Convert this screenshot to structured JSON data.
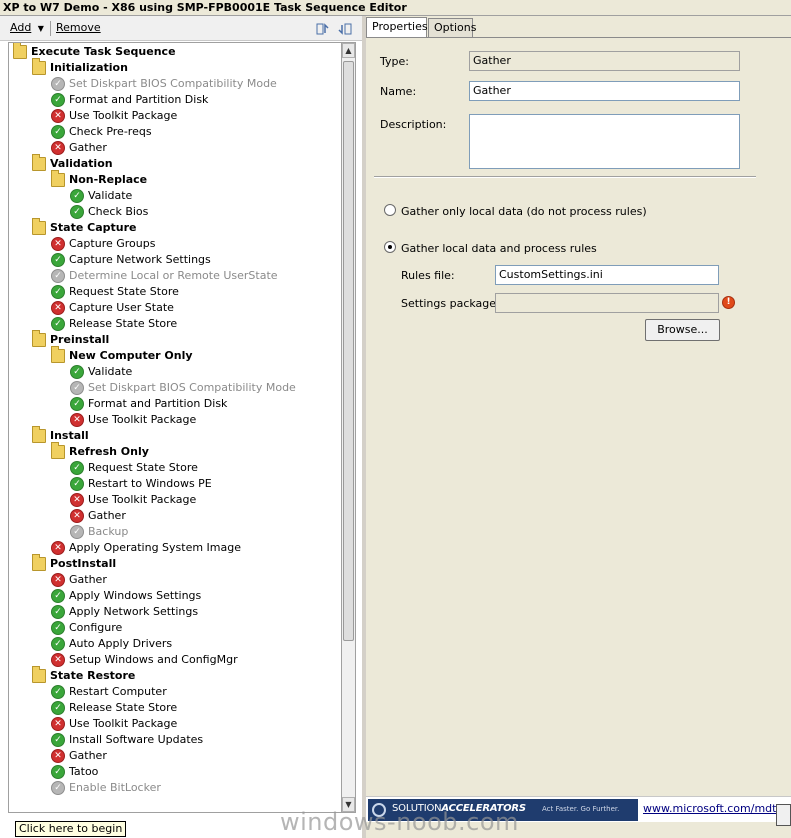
{
  "window": {
    "title": "XP to W7 Demo - X86 using SMP-FPB0001E Task Sequence Editor"
  },
  "toolbar": {
    "add_label": "Add",
    "remove_label": "Remove",
    "add_underline": "A",
    "remove_underline": "R"
  },
  "tree": {
    "items": [
      {
        "label": "Execute Task Sequence",
        "kind": "group",
        "depth": 0
      },
      {
        "label": "Initialization",
        "kind": "group",
        "depth": 1
      },
      {
        "label": "Set Diskpart BIOS Compatibility Mode",
        "kind": "disabled",
        "depth": 2
      },
      {
        "label": "Format and Partition Disk",
        "kind": "ok",
        "depth": 2
      },
      {
        "label": "Use Toolkit Package",
        "kind": "error",
        "depth": 2
      },
      {
        "label": "Check Pre-reqs",
        "kind": "ok",
        "depth": 2
      },
      {
        "label": "Gather",
        "kind": "error",
        "depth": 2
      },
      {
        "label": "Validation",
        "kind": "group",
        "depth": 1
      },
      {
        "label": "Non-Replace",
        "kind": "group",
        "depth": 2
      },
      {
        "label": "Validate",
        "kind": "ok",
        "depth": 3
      },
      {
        "label": "Check Bios",
        "kind": "ok",
        "depth": 3
      },
      {
        "label": "State Capture",
        "kind": "group",
        "depth": 1
      },
      {
        "label": "Capture Groups",
        "kind": "error",
        "depth": 2
      },
      {
        "label": "Capture Network Settings",
        "kind": "ok",
        "depth": 2
      },
      {
        "label": "Determine Local or Remote UserState",
        "kind": "disabled",
        "depth": 2
      },
      {
        "label": "Request State Store",
        "kind": "ok",
        "depth": 2
      },
      {
        "label": "Capture User State",
        "kind": "error",
        "depth": 2
      },
      {
        "label": "Release State Store",
        "kind": "ok",
        "depth": 2
      },
      {
        "label": "Preinstall",
        "kind": "group",
        "depth": 1
      },
      {
        "label": "New Computer Only",
        "kind": "group",
        "depth": 2
      },
      {
        "label": "Validate",
        "kind": "ok",
        "depth": 3
      },
      {
        "label": "Set Diskpart BIOS Compatibility Mode",
        "kind": "disabled",
        "depth": 3
      },
      {
        "label": "Format and Partition Disk",
        "kind": "ok",
        "depth": 3
      },
      {
        "label": "Use Toolkit Package",
        "kind": "error",
        "depth": 3
      },
      {
        "label": "Install",
        "kind": "group",
        "depth": 1
      },
      {
        "label": "Refresh Only",
        "kind": "group",
        "depth": 2
      },
      {
        "label": "Request State Store",
        "kind": "ok",
        "depth": 3
      },
      {
        "label": "Restart to Windows PE",
        "kind": "ok",
        "depth": 3
      },
      {
        "label": "Use Toolkit Package",
        "kind": "error",
        "depth": 3
      },
      {
        "label": "Gather",
        "kind": "error",
        "depth": 3
      },
      {
        "label": "Backup",
        "kind": "disabled",
        "depth": 3
      },
      {
        "label": "Apply Operating System Image",
        "kind": "error",
        "depth": 2
      },
      {
        "label": "PostInstall",
        "kind": "group",
        "depth": 1
      },
      {
        "label": "Gather",
        "kind": "error",
        "depth": 2
      },
      {
        "label": "Apply Windows Settings",
        "kind": "ok",
        "depth": 2
      },
      {
        "label": "Apply Network Settings",
        "kind": "ok",
        "depth": 2
      },
      {
        "label": "Configure",
        "kind": "ok",
        "depth": 2
      },
      {
        "label": "Auto Apply Drivers",
        "kind": "ok",
        "depth": 2
      },
      {
        "label": "Setup Windows and ConfigMgr",
        "kind": "error",
        "depth": 2
      },
      {
        "label": "State Restore",
        "kind": "group",
        "depth": 1
      },
      {
        "label": "Restart Computer",
        "kind": "ok",
        "depth": 2
      },
      {
        "label": "Release State Store",
        "kind": "ok",
        "depth": 2
      },
      {
        "label": "Use Toolkit Package",
        "kind": "error",
        "depth": 2
      },
      {
        "label": "Install Software Updates",
        "kind": "ok",
        "depth": 2
      },
      {
        "label": "Gather",
        "kind": "error",
        "depth": 2
      },
      {
        "label": "Tatoo",
        "kind": "ok",
        "depth": 2
      },
      {
        "label": "Enable BitLocker",
        "kind": "disabled",
        "depth": 2
      }
    ]
  },
  "tabs": [
    {
      "label": "Properties",
      "active": true
    },
    {
      "label": "Options",
      "active": false
    }
  ],
  "properties": {
    "type_label": "Type:",
    "type_value": "Gather",
    "name_label": "Name:",
    "name_value": "Gather",
    "description_label": "Description:",
    "description_value": "",
    "radio_local_only": "Gather only local data (do not process rules)",
    "radio_process_rules": "Gather local data and process rules",
    "selected_radio": "process_rules",
    "rules_file_label": "Rules file:",
    "rules_file_value": "CustomSettings.ini",
    "settings_package_label": "Settings package:",
    "settings_package_value": "",
    "browse_label": "Browse..."
  },
  "footer": {
    "brand_prefix": "SOLUTION",
    "brand_bold": "ACCELERATORS",
    "tagline": "Act Faster. Go Further.",
    "link": "www.microsoft.com/mdt"
  },
  "status_tip": "Click here to begin",
  "watermark": "windows-noob.com",
  "colors": {
    "ok": "#3aa63a",
    "error": "#d03030",
    "disabled": "#b6b6b6",
    "folder": "#f0d060",
    "brand": "#1f3c6e"
  }
}
